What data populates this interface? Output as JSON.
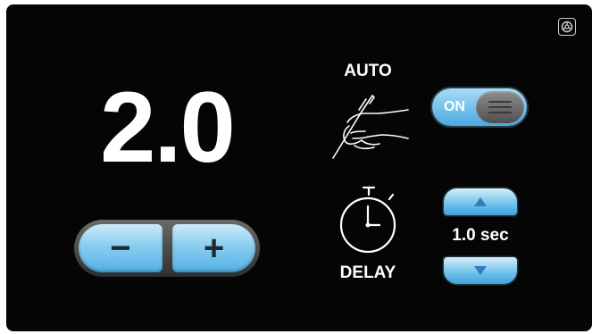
{
  "main": {
    "value": "2.0",
    "minus_label": "−",
    "plus_label": "+"
  },
  "auto": {
    "label": "AUTO",
    "toggle_state": "ON",
    "icon": "hand-pen-icon"
  },
  "delay": {
    "label": "DELAY",
    "value": "1.0 sec",
    "icon": "stopwatch-icon",
    "up_icon": "triangle-up-icon",
    "down_icon": "triangle-down-icon"
  },
  "header": {
    "settings_icon": "settings-icon"
  },
  "colors": {
    "background": "#050505",
    "accent_blue": "#52b1e4",
    "arrow_icon": "#2f7fb8"
  }
}
